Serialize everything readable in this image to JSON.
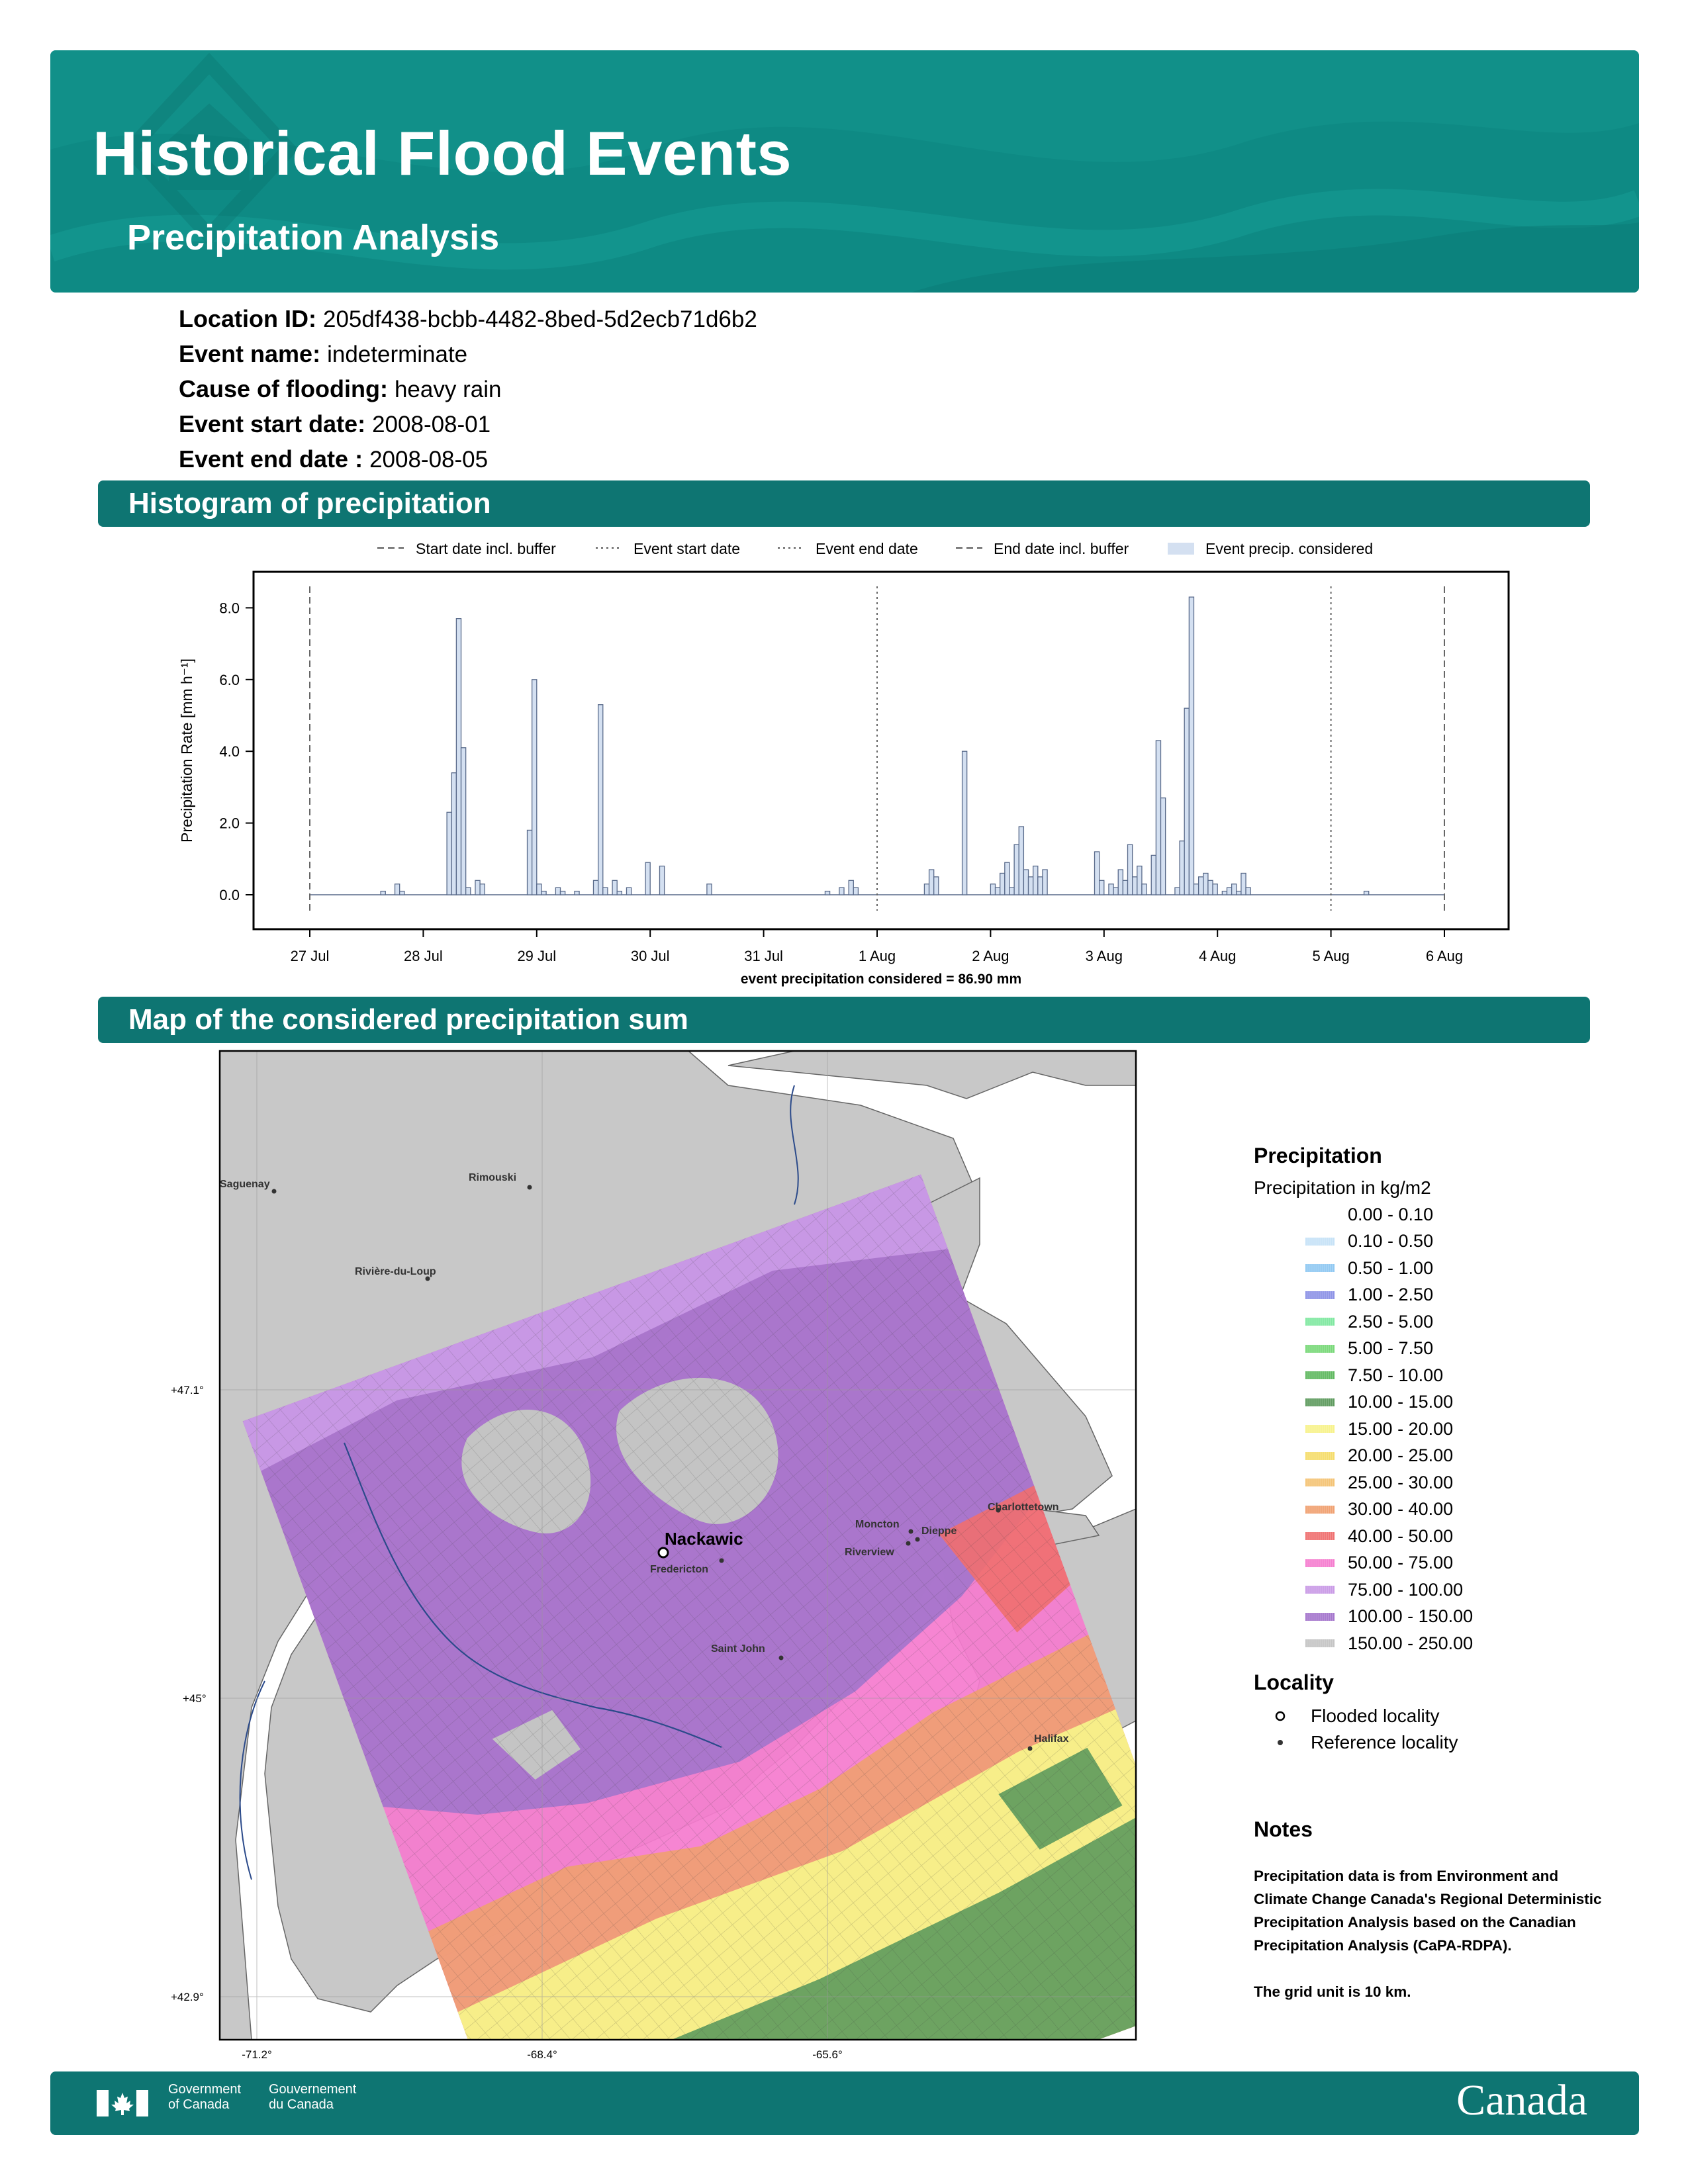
{
  "header": {
    "title": "Historical Flood Events",
    "subtitle": "Precipitation Analysis"
  },
  "event": {
    "location_label": "Location ID:",
    "location_value": "205df438-bcbb-4482-8bed-5d2ecb71d6b2",
    "name_label": "Event name:",
    "name_value": "indeterminate",
    "cause_label": "Cause of flooding:",
    "cause_value": "heavy rain",
    "start_label": "Event start date:",
    "start_value": "2008-08-01",
    "end_label": "Event end date :",
    "end_value": "2008-08-05"
  },
  "sections": {
    "histogram": "Histogram of precipitation",
    "map": "Map of the considered precipitation sum"
  },
  "chart_data": {
    "type": "bar",
    "ylabel": "Precipitation Rate [mm h⁻¹]",
    "xlabel": "event precipitation considered = 86.90 mm",
    "ylim": [
      -0.4,
      9.0
    ],
    "yticks": [
      "0.0",
      "2.0",
      "4.0",
      "6.0",
      "8.0"
    ],
    "xticks": [
      "27 Jul",
      "28 Jul",
      "29 Jul",
      "30 Jul",
      "31 Jul",
      "1 Aug",
      "2 Aug",
      "3 Aug",
      "4 Aug",
      "5 Aug",
      "6 Aug"
    ],
    "x_unit": "hours since 27 Jul 00:00",
    "legend": {
      "placement": "top",
      "items": [
        "Start date incl. buffer",
        "Event start date",
        "Event end date",
        "End date incl. buffer",
        "Event precip. considered"
      ]
    },
    "vlines": [
      {
        "label": "Start date incl. buffer",
        "x": 0,
        "style": "dashed"
      },
      {
        "label": "Event start date",
        "x": 120,
        "style": "dotted"
      },
      {
        "label": "Event end date",
        "x": 216,
        "style": "dotted"
      },
      {
        "label": "End date incl. buffer",
        "x": 240,
        "style": "dashed"
      }
    ],
    "series": [
      {
        "name": "Event precip. considered",
        "color": "#d4e0f1",
        "bars": [
          [
            15,
            0.1
          ],
          [
            18,
            0.3
          ],
          [
            19,
            0.1
          ],
          [
            29,
            2.3
          ],
          [
            30,
            3.4
          ],
          [
            31,
            7.7
          ],
          [
            32,
            4.1
          ],
          [
            33,
            0.2
          ],
          [
            35,
            0.4
          ],
          [
            36,
            0.3
          ],
          [
            46,
            1.8
          ],
          [
            47,
            6.0
          ],
          [
            48,
            0.3
          ],
          [
            49,
            0.1
          ],
          [
            52,
            0.2
          ],
          [
            53,
            0.1
          ],
          [
            56,
            0.1
          ],
          [
            60,
            0.4
          ],
          [
            61,
            5.3
          ],
          [
            62,
            0.2
          ],
          [
            64,
            0.4
          ],
          [
            65,
            0.1
          ],
          [
            67,
            0.2
          ],
          [
            71,
            0.9
          ],
          [
            74,
            0.8
          ],
          [
            84,
            0.3
          ],
          [
            109,
            0.1
          ],
          [
            112,
            0.2
          ],
          [
            114,
            0.4
          ],
          [
            115,
            0.2
          ],
          [
            130,
            0.3
          ],
          [
            131,
            0.7
          ],
          [
            132,
            0.5
          ],
          [
            138,
            4.0
          ],
          [
            144,
            0.3
          ],
          [
            145,
            0.2
          ],
          [
            146,
            0.6
          ],
          [
            147,
            0.9
          ],
          [
            148,
            0.2
          ],
          [
            149,
            1.4
          ],
          [
            150,
            1.9
          ],
          [
            151,
            0.7
          ],
          [
            152,
            0.5
          ],
          [
            153,
            0.8
          ],
          [
            154,
            0.5
          ],
          [
            155,
            0.7
          ],
          [
            166,
            1.2
          ],
          [
            167,
            0.4
          ],
          [
            169,
            0.3
          ],
          [
            170,
            0.2
          ],
          [
            171,
            0.7
          ],
          [
            172,
            0.4
          ],
          [
            173,
            1.4
          ],
          [
            174,
            0.5
          ],
          [
            175,
            0.8
          ],
          [
            176,
            0.3
          ],
          [
            178,
            1.1
          ],
          [
            179,
            4.3
          ],
          [
            180,
            2.7
          ],
          [
            183,
            0.2
          ],
          [
            184,
            1.5
          ],
          [
            185,
            5.2
          ],
          [
            186,
            8.3
          ],
          [
            187,
            0.3
          ],
          [
            188,
            0.5
          ],
          [
            189,
            0.6
          ],
          [
            190,
            0.4
          ],
          [
            191,
            0.3
          ],
          [
            193,
            0.1
          ],
          [
            194,
            0.2
          ],
          [
            195,
            0.3
          ],
          [
            196,
            0.1
          ],
          [
            197,
            0.6
          ],
          [
            198,
            0.2
          ],
          [
            223,
            0.1
          ]
        ]
      }
    ]
  },
  "map": {
    "lat_labels": [
      "+47.1°",
      "+45°",
      "+42.9°"
    ],
    "lon_labels": [
      "-71.2°",
      "-68.4°",
      "-65.6°"
    ],
    "flooded_locality": "Nackawic",
    "reference_localities": [
      "Saguenay",
      "Rimouski",
      "Rivière-du-Loup",
      "Fredericton",
      "Moncton",
      "Dieppe",
      "Riverview",
      "Charlottetown",
      "Saint John",
      "Halifax"
    ]
  },
  "legend": {
    "title": "Precipitation",
    "subtitle": "Precipitation in kg/m2",
    "classes": [
      {
        "label": "0.00 - 0.10",
        "color": "#ffffff"
      },
      {
        "label": "0.10 - 0.50",
        "color": "#c6e2f7"
      },
      {
        "label": "0.50 - 1.00",
        "color": "#8fc8f2"
      },
      {
        "label": "1.00 - 2.50",
        "color": "#8c92e6"
      },
      {
        "label": "2.50 - 5.00",
        "color": "#7fe8a0"
      },
      {
        "label": "5.00 - 7.50",
        "color": "#78d878"
      },
      {
        "label": "7.50 - 10.00",
        "color": "#5fb85f"
      },
      {
        "label": "10.00 - 15.00",
        "color": "#5d9a5d"
      },
      {
        "label": "15.00 - 20.00",
        "color": "#f7f28a"
      },
      {
        "label": "20.00 - 25.00",
        "color": "#f5dc6a"
      },
      {
        "label": "25.00 - 30.00",
        "color": "#f4c374"
      },
      {
        "label": "30.00 - 40.00",
        "color": "#f0a070"
      },
      {
        "label": "40.00 - 50.00",
        "color": "#ef6f6f"
      },
      {
        "label": "50.00 - 75.00",
        "color": "#f57ccf"
      },
      {
        "label": "75.00 - 100.00",
        "color": "#c99ae6"
      },
      {
        "label": "100.00 - 150.00",
        "color": "#a475cc"
      },
      {
        "label": "150.00 - 250.00",
        "color": "#c4c4c4"
      }
    ],
    "locality_title": "Locality",
    "flooded_label": "Flooded locality",
    "reference_label": "Reference locality"
  },
  "notes": {
    "title": "Notes",
    "text1": "Precipitation data is from Environment and Climate Change Canada's Regional Deterministic Precipitation Analysis based on the Canadian Precipitation Analysis (CaPA-RDPA).",
    "text2": "The grid unit is 10 km."
  },
  "footer": {
    "gov_en_1": "Government",
    "gov_en_2": "of Canada",
    "gov_fr_1": "Gouvernement",
    "gov_fr_2": "du Canada",
    "wordmark": "Canada"
  }
}
